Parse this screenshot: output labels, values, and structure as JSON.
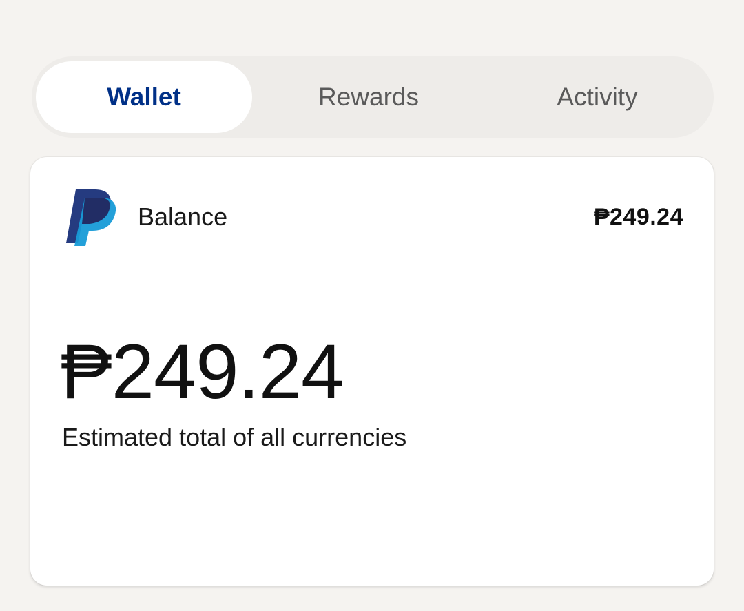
{
  "tabs": [
    {
      "label": "Wallet",
      "active": true
    },
    {
      "label": "Rewards",
      "active": false
    },
    {
      "label": "Activity",
      "active": false
    }
  ],
  "balance_card": {
    "logo_icon": "paypal-logo-icon",
    "label": "Balance",
    "amount_short": "₱249.24",
    "total_amount": "₱249.24",
    "caption": "Estimated total of all currencies"
  },
  "colors": {
    "background": "#f5f3f0",
    "tab_track": "#eeece9",
    "active_tab_text": "#003087",
    "inactive_tab_text": "#5a5a5a",
    "paypal_dark_blue": "#253b80",
    "paypal_light_blue": "#179bd7"
  }
}
